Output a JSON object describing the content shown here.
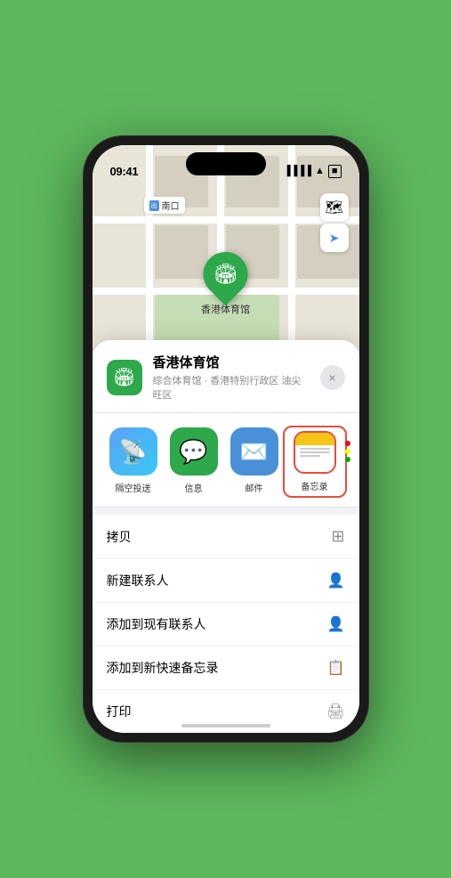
{
  "statusBar": {
    "time": "09:41",
    "locationIcon": "▶"
  },
  "map": {
    "locationLabel": "南口",
    "locationLabelPrefix": "出口"
  },
  "venue": {
    "name": "香港体育馆",
    "subtitle": "综合体育馆 · 香港特别行政区 油尖旺区",
    "pinLabel": "香港体育馆"
  },
  "shareActions": [
    {
      "id": "airdrop",
      "label": "隔空投送",
      "bgClass": "airdrop-bg",
      "icon": "📡"
    },
    {
      "id": "messages",
      "label": "信息",
      "bgClass": "messages-bg",
      "icon": "💬"
    },
    {
      "id": "mail",
      "label": "邮件",
      "bgClass": "mail-bg",
      "icon": "✉️"
    },
    {
      "id": "notes",
      "label": "备忘录",
      "bgClass": "notes-special",
      "icon": "notes"
    }
  ],
  "moreDots": {
    "colors": [
      "#f00",
      "#ff0",
      "#0c0"
    ]
  },
  "actionItems": [
    {
      "id": "copy",
      "label": "拷贝",
      "icon": "⊞"
    },
    {
      "id": "new-contact",
      "label": "新建联系人",
      "icon": "👤"
    },
    {
      "id": "add-existing",
      "label": "添加到现有联系人",
      "icon": "👤"
    },
    {
      "id": "add-notes",
      "label": "添加到新快速备忘录",
      "icon": "📋"
    },
    {
      "id": "print",
      "label": "打印",
      "icon": "🖨"
    }
  ],
  "buttons": {
    "close": "×",
    "mapType": "🗺",
    "mapLocation": "➤"
  }
}
